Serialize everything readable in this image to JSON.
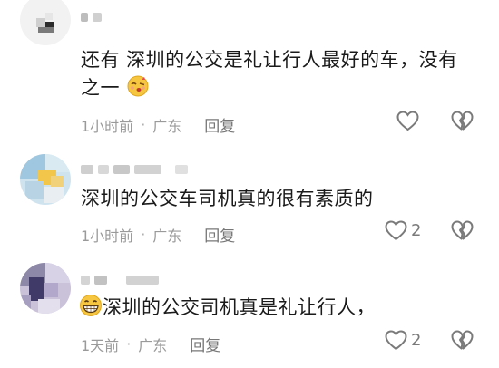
{
  "comments": [
    {
      "text_line1": "还有 深圳的公交是礼让行人最好的车，没有",
      "text_line2": "之一",
      "time": "1小时前",
      "location": "广东",
      "reply_label": "回复",
      "like_count": ""
    },
    {
      "text": "深圳的公交车司机真的很有素质的",
      "time": "1小时前",
      "location": "广东",
      "reply_label": "回复",
      "like_count": "2"
    },
    {
      "text": "深圳的公交司机真是礼让行人，",
      "time": "1天前",
      "location": "广东",
      "reply_label": "回复",
      "like_count": "2"
    }
  ],
  "separator": "·",
  "icons": {
    "like": "heart-outline-icon",
    "dislike": "broken-heart-icon",
    "emoji_kiss": "kiss-wink-emoji-icon",
    "emoji_grin": "grinning-emoji-icon"
  },
  "colors": {
    "text": "#1a1a1a",
    "meta": "#9a9a9a",
    "icon": "#7a7a7a"
  }
}
